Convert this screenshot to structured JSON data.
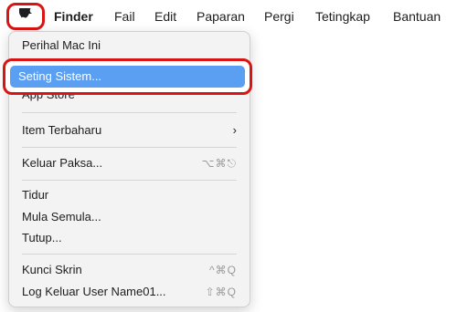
{
  "menubar": {
    "apple_icon": "apple-logo",
    "items": [
      {
        "label": "Finder"
      },
      {
        "label": "Fail"
      },
      {
        "label": "Edit"
      },
      {
        "label": "Paparan"
      },
      {
        "label": "Pergi"
      },
      {
        "label": "Tetingkap"
      },
      {
        "label": "Bantuan"
      }
    ]
  },
  "apple_menu": {
    "items": [
      {
        "label": "Perihal Mac Ini"
      },
      {
        "label": "Seting Sistem...",
        "highlighted": true
      },
      {
        "label": "App Store"
      },
      {
        "label": "Item Terbaharu",
        "submenu": true,
        "chevron": "›"
      },
      {
        "label": "Keluar Paksa...",
        "shortcut": "⌥⌘⎋"
      },
      {
        "label": "Tidur"
      },
      {
        "label": "Mula Semula..."
      },
      {
        "label": "Tutup..."
      },
      {
        "label": "Kunci Skrin",
        "shortcut": "^⌘Q"
      },
      {
        "label": "Log Keluar User Name01...",
        "shortcut": "⇧⌘Q"
      }
    ]
  },
  "colors": {
    "annotation_red": "#d91414",
    "highlight_blue": "#5a9ff2",
    "menu_bg": "#f3f3f3"
  }
}
